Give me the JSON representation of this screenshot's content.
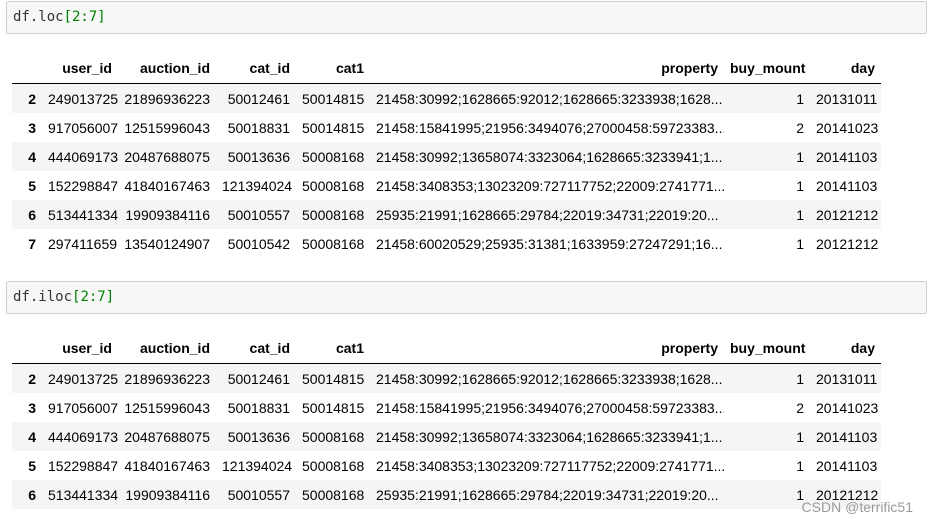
{
  "cells": [
    {
      "code_prefix": "df.loc",
      "code_arg": "[2:7]",
      "columns": [
        "",
        "user_id",
        "auction_id",
        "cat_id",
        "cat1",
        "property",
        "buy_mount",
        "day"
      ],
      "rows": [
        [
          "2",
          "249013725",
          "21896936223",
          "50012461",
          "50014815",
          "21458:30992;1628665:92012;1628665:3233938;1628...",
          "1",
          "20131011"
        ],
        [
          "3",
          "917056007",
          "12515996043",
          "50018831",
          "50014815",
          "21458:15841995;21956:3494076;27000458:59723383...",
          "2",
          "20141023"
        ],
        [
          "4",
          "444069173",
          "20487688075",
          "50013636",
          "50008168",
          "21458:30992;13658074:3323064;1628665:3233941;1...",
          "1",
          "20141103"
        ],
        [
          "5",
          "152298847",
          "41840167463",
          "121394024",
          "50008168",
          "21458:3408353;13023209:727117752;22009:2741771...",
          "1",
          "20141103"
        ],
        [
          "6",
          "513441334",
          "19909384116",
          "50010557",
          "50008168",
          "25935:21991;1628665:29784;22019:34731;22019:20...",
          "1",
          "20121212"
        ],
        [
          "7",
          "297411659",
          "13540124907",
          "50010542",
          "50008168",
          "21458:60020529;25935:31381;1633959:27247291;16...",
          "1",
          "20121212"
        ]
      ]
    },
    {
      "code_prefix": "df.iloc",
      "code_arg": "[2:7]",
      "columns": [
        "",
        "user_id",
        "auction_id",
        "cat_id",
        "cat1",
        "property",
        "buy_mount",
        "day"
      ],
      "rows": [
        [
          "2",
          "249013725",
          "21896936223",
          "50012461",
          "50014815",
          "21458:30992;1628665:92012;1628665:3233938;1628...",
          "1",
          "20131011"
        ],
        [
          "3",
          "917056007",
          "12515996043",
          "50018831",
          "50014815",
          "21458:15841995;21956:3494076;27000458:59723383...",
          "2",
          "20141023"
        ],
        [
          "4",
          "444069173",
          "20487688075",
          "50013636",
          "50008168",
          "21458:30992;13658074:3323064;1628665:3233941;1...",
          "1",
          "20141103"
        ],
        [
          "5",
          "152298847",
          "41840167463",
          "121394024",
          "50008168",
          "21458:3408353;13023209:727117752;22009:2741771...",
          "1",
          "20141103"
        ],
        [
          "6",
          "513441334",
          "19909384116",
          "50010557",
          "50008168",
          "25935:21991;1628665:29784;22019:34731;22019:20...",
          "1",
          "20121212"
        ]
      ]
    }
  ],
  "watermark": "CSDN @terrific51",
  "colors": {
    "code_arg": "#008000",
    "stripe": "#f5f5f5",
    "cell_bg": "#f7f7f7"
  }
}
